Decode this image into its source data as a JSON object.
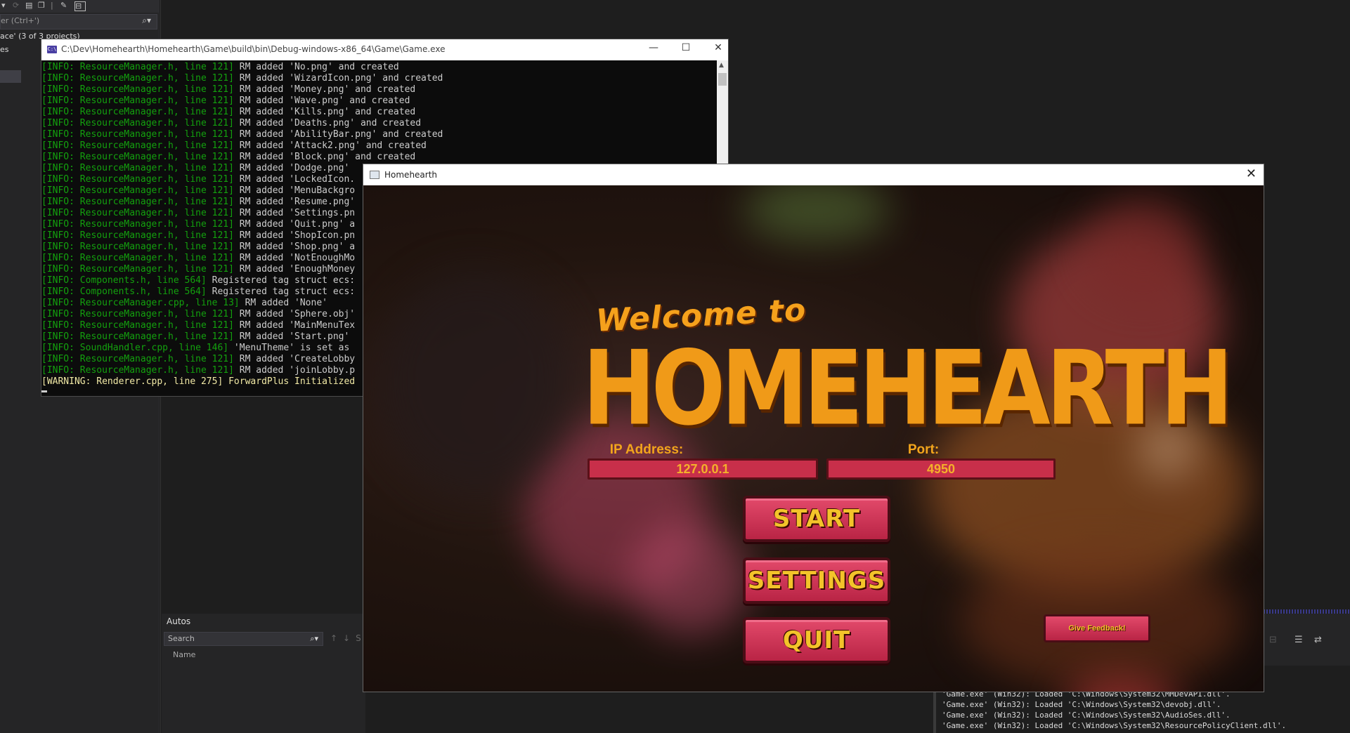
{
  "ide": {
    "search_placeholder": "er (Ctrl+')",
    "solution_text": "ace' (3 of 3 projects)",
    "left_item": "es",
    "autos": {
      "title": "Autos",
      "search_placeholder": "Search",
      "col_name": "Name"
    },
    "output_lines": [
      "'Game.exe' (Win32): Loaded 'C:\\Windows\\System32\\MMDevAPI.dll'.",
      "'Game.exe' (Win32): Loaded 'C:\\Windows\\System32\\devobj.dll'.",
      "'Game.exe' (Win32): Loaded 'C:\\Windows\\System32\\AudioSes.dll'.",
      "'Game.exe' (Win32): Loaded 'C:\\Windows\\System32\\ResourcePolicyClient.dll'."
    ]
  },
  "console": {
    "title": "C:\\Dev\\Homehearth\\Homehearth\\Game\\build\\bin\\Debug-windows-x86_64\\Game\\Game.exe",
    "icon_text": "C:\\",
    "lines": [
      {
        "p": "[INFO: ResourceManager.h, line 121]",
        "m": " RM added 'No.png' and created"
      },
      {
        "p": "[INFO: ResourceManager.h, line 121]",
        "m": " RM added 'WizardIcon.png' and created"
      },
      {
        "p": "[INFO: ResourceManager.h, line 121]",
        "m": " RM added 'Money.png' and created"
      },
      {
        "p": "[INFO: ResourceManager.h, line 121]",
        "m": " RM added 'Wave.png' and created"
      },
      {
        "p": "[INFO: ResourceManager.h, line 121]",
        "m": " RM added 'Kills.png' and created"
      },
      {
        "p": "[INFO: ResourceManager.h, line 121]",
        "m": " RM added 'Deaths.png' and created"
      },
      {
        "p": "[INFO: ResourceManager.h, line 121]",
        "m": " RM added 'AbilityBar.png' and created"
      },
      {
        "p": "[INFO: ResourceManager.h, line 121]",
        "m": " RM added 'Attack2.png' and created"
      },
      {
        "p": "[INFO: ResourceManager.h, line 121]",
        "m": " RM added 'Block.png' and created"
      },
      {
        "p": "[INFO: ResourceManager.h, line 121]",
        "m": " RM added 'Dodge.png'"
      },
      {
        "p": "[INFO: ResourceManager.h, line 121]",
        "m": " RM added 'LockedIcon."
      },
      {
        "p": "[INFO: ResourceManager.h, line 121]",
        "m": " RM added 'MenuBackgro"
      },
      {
        "p": "[INFO: ResourceManager.h, line 121]",
        "m": " RM added 'Resume.png'"
      },
      {
        "p": "[INFO: ResourceManager.h, line 121]",
        "m": " RM added 'Settings.pn"
      },
      {
        "p": "[INFO: ResourceManager.h, line 121]",
        "m": " RM added 'Quit.png' a"
      },
      {
        "p": "[INFO: ResourceManager.h, line 121]",
        "m": " RM added 'ShopIcon.pn"
      },
      {
        "p": "[INFO: ResourceManager.h, line 121]",
        "m": " RM added 'Shop.png' a"
      },
      {
        "p": "[INFO: ResourceManager.h, line 121]",
        "m": " RM added 'NotEnoughMo"
      },
      {
        "p": "[INFO: ResourceManager.h, line 121]",
        "m": " RM added 'EnoughMoney"
      },
      {
        "p": "[INFO: Components.h, line 564]",
        "m": " Registered tag struct ecs:"
      },
      {
        "p": "[INFO: Components.h, line 564]",
        "m": " Registered tag struct ecs:"
      },
      {
        "p": "[INFO: ResourceManager.cpp, line 13]",
        "m": " RM added 'None'"
      },
      {
        "p": "[INFO: ResourceManager.h, line 121]",
        "m": " RM added 'Sphere.obj'"
      },
      {
        "p": "[INFO: ResourceManager.h, line 121]",
        "m": " RM added 'MainMenuTex"
      },
      {
        "p": "[INFO: ResourceManager.h, line 121]",
        "m": " RM added 'Start.png'"
      },
      {
        "p": "[INFO: SoundHandler.cpp, line 146]",
        "m": " 'MenuTheme' is set as"
      },
      {
        "p": "[INFO: ResourceManager.h, line 121]",
        "m": " RM added 'CreateLobby"
      },
      {
        "p": "[INFO: ResourceManager.h, line 121]",
        "m": " RM added 'joinLobby.p"
      }
    ],
    "warning": "[WARNING: Renderer.cpp, line 275] ForwardPlus Initialized",
    "colors": {
      "info": "#13a10e",
      "text": "#cccccc",
      "warning": "#f1e9a5"
    }
  },
  "game": {
    "title": "Homehearth",
    "welcome": "Welcome to",
    "logo": "HOMEHEARTH",
    "ip_label": "IP Address:",
    "ip_value": "127.0.0.1",
    "port_label": "Port:",
    "port_value": "4950",
    "start": "START",
    "settings": "SETTINGS",
    "quit": "QUIT",
    "feedback": "Give Feedback!",
    "colors": {
      "accent": "#f09a18",
      "button": "#c82f4a",
      "button_text": "#f3c32a"
    }
  }
}
